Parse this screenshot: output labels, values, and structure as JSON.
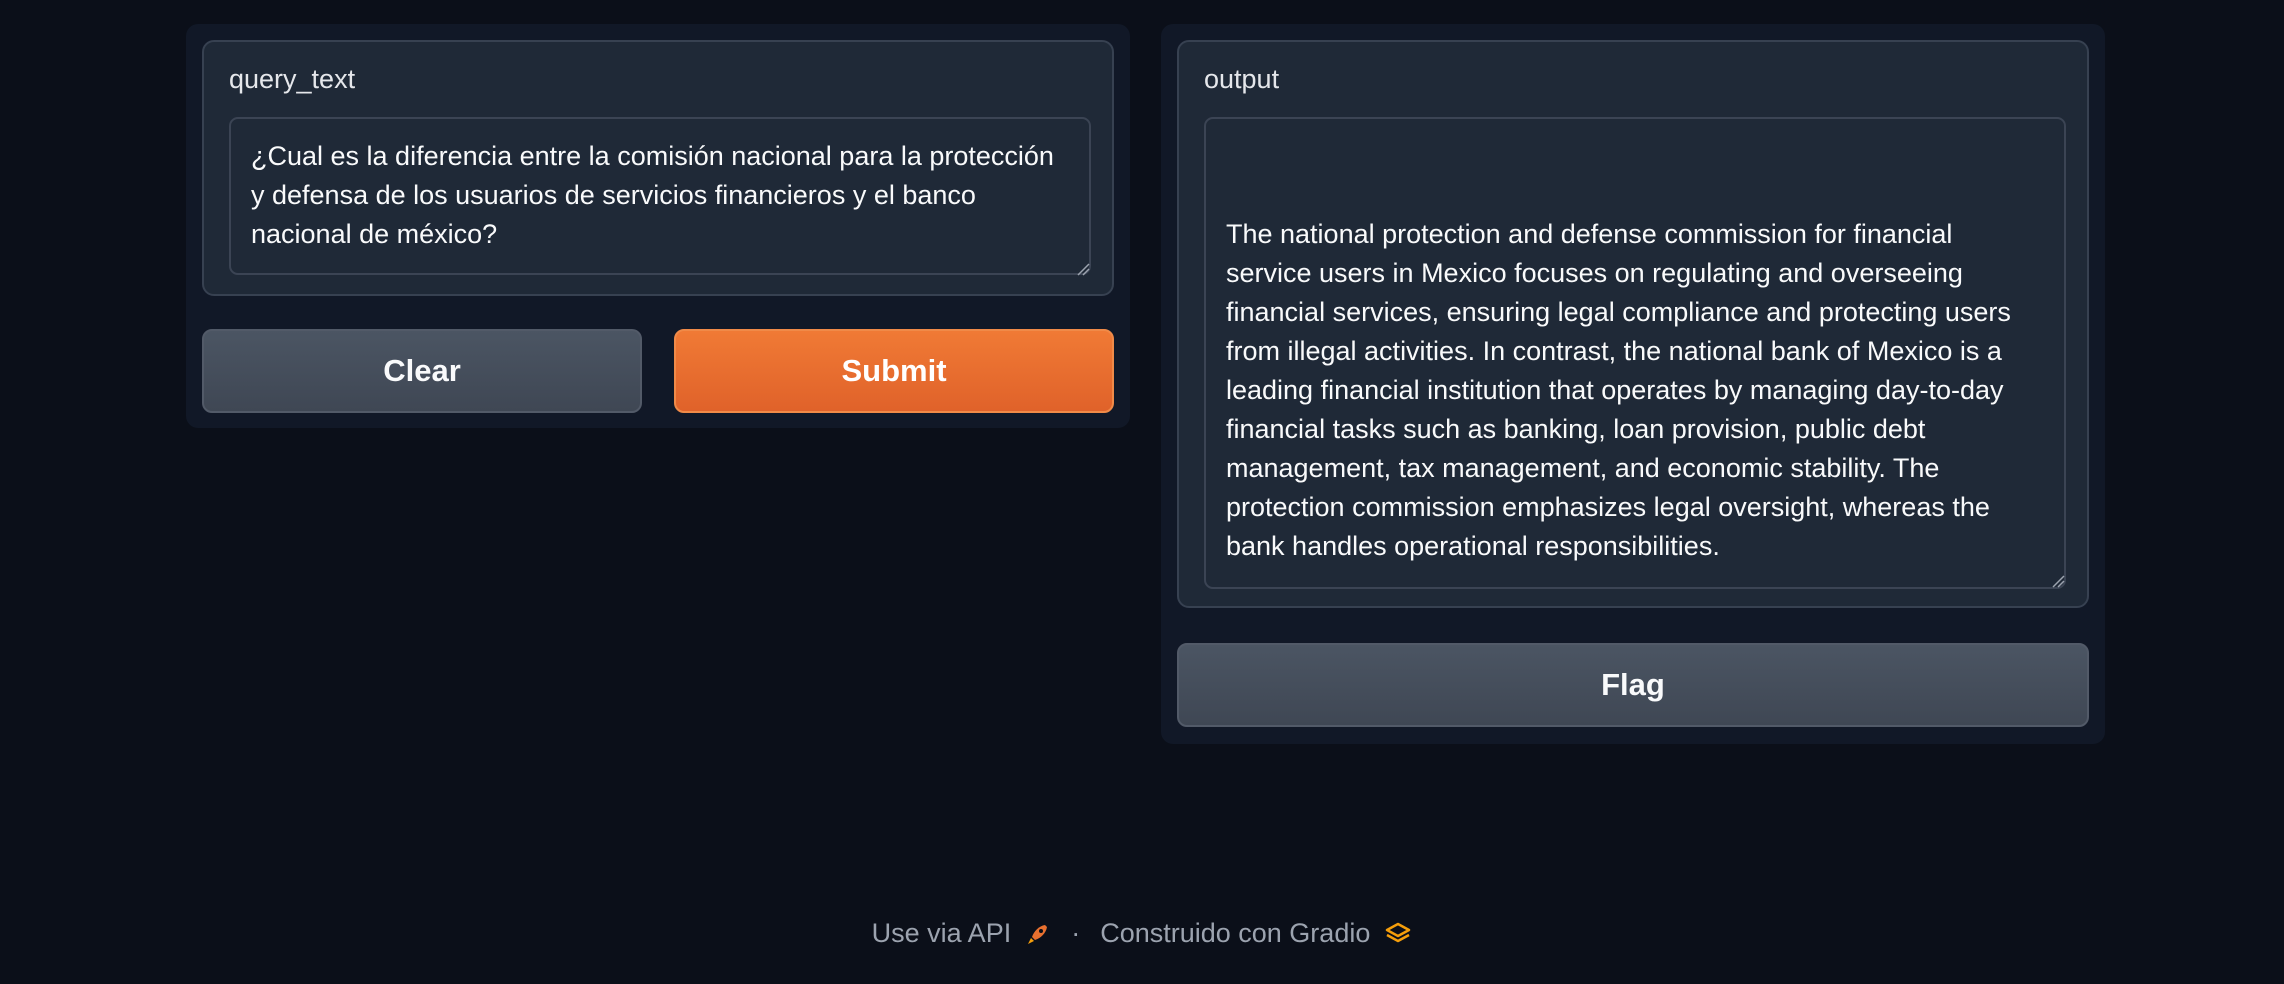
{
  "input": {
    "label": "query_text",
    "value": "¿Cual es la diferencia entre la comisión nacional para la protección y defensa de los usuarios de servicios financieros y el banco nacional de méxico?"
  },
  "buttons": {
    "clear": "Clear",
    "submit": "Submit",
    "flag": "Flag"
  },
  "output": {
    "label": "output",
    "value": "The national protection and defense commission for financial service users in Mexico focuses on regulating and overseeing financial services, ensuring legal compliance and protecting users from illegal activities. In contrast, the national bank of Mexico is a leading financial institution that operates by managing day-to-day financial tasks such as banking, loan provision, public debt management, tax management, and economic stability. The protection commission emphasizes legal oversight, whereas the bank handles operational responsibilities."
  },
  "footer": {
    "api_link": "Use via API",
    "separator": "·",
    "built_with": "Construido con Gradio"
  },
  "colors": {
    "background": "#0b0f19",
    "primary": "#e8702f",
    "gradio_logo": "#f59e0b"
  },
  "icons": {
    "api": "rocket-icon",
    "gradio": "gradio-logo-icon"
  }
}
